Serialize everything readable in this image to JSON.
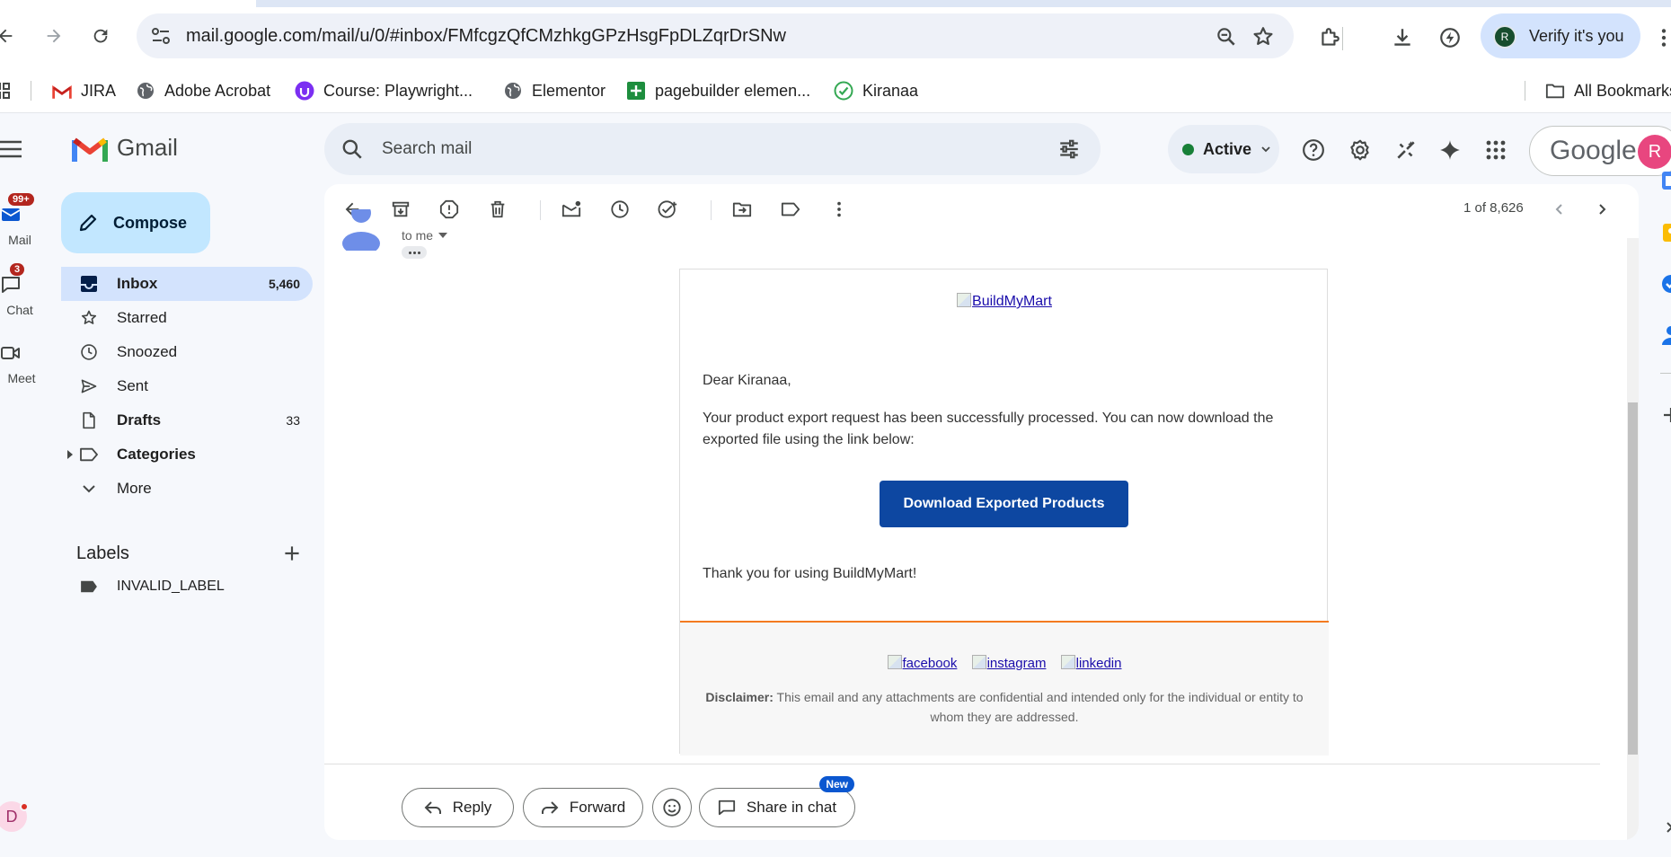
{
  "browser": {
    "url": "mail.google.com/mail/u/0/#inbox/FMfcgzQfCMzhkgGPzHsgFpDLZqrDrSNw",
    "verify_label": "Verify it's you",
    "verify_avatar": "R",
    "bookmarks": [
      {
        "label": "JIRA",
        "icon": "gmail-icon"
      },
      {
        "label": "Adobe Acrobat",
        "icon": "globe-icon"
      },
      {
        "label": "Course: Playwright...",
        "icon": "udemy-icon"
      },
      {
        "label": "Elementor",
        "icon": "globe-icon"
      },
      {
        "label": "pagebuilder elemen...",
        "icon": "sheets-icon"
      },
      {
        "label": "Kiranaa",
        "icon": "check-icon"
      }
    ],
    "all_bookmarks": "All Bookmarks"
  },
  "gmail": {
    "product_name": "Gmail",
    "search_placeholder": "Search mail",
    "status": "Active",
    "account_brand": "Google",
    "account_avatar": "R",
    "rail": [
      {
        "label": "Mail",
        "badge": "99+"
      },
      {
        "label": "Chat",
        "badge": "3"
      },
      {
        "label": "Meet",
        "badge": ""
      }
    ],
    "rail_bottom_avatar": "D",
    "compose_label": "Compose",
    "nav": [
      {
        "label": "Inbox",
        "count": "5,460",
        "icon": "inbox-icon"
      },
      {
        "label": "Starred",
        "count": "",
        "icon": "star-icon"
      },
      {
        "label": "Snoozed",
        "count": "",
        "icon": "clock-icon"
      },
      {
        "label": "Sent",
        "count": "",
        "icon": "send-icon"
      },
      {
        "label": "Drafts",
        "count": "33",
        "icon": "draft-icon"
      },
      {
        "label": "Categories",
        "count": "",
        "icon": "label-icon"
      },
      {
        "label": "More",
        "count": "",
        "icon": "chevron-down-icon"
      }
    ],
    "labels_title": "Labels",
    "labels": [
      "INVALID_LABEL"
    ]
  },
  "message": {
    "pager": "1 of 8,626",
    "recipient": "to me",
    "logo_alt": "BuildMyMart",
    "greeting": "Dear Kiranaa,",
    "body": "Your product export request has been successfully processed. You can now download the exported file using the link below:",
    "button_label": "Download Exported Products",
    "thanks": "Thank you for using BuildMyMart!",
    "socials": [
      "facebook",
      "instagram",
      "linkedin"
    ],
    "disclaimer_label": "Disclaimer:",
    "disclaimer_text": " This email and any attachments are confidential and intended only for the individual or entity to whom they are addressed.",
    "reply_label": "Reply",
    "forward_label": "Forward",
    "share_label": "Share in chat",
    "new_badge": "New"
  },
  "colors": {
    "accent": "#0b57d0",
    "compose_bg": "#c2e7ff",
    "active_nav_bg": "#d3e3fd",
    "email_button": "#0d47a1",
    "footer_rule": "#f47b20",
    "badge_red": "#b3261e"
  }
}
